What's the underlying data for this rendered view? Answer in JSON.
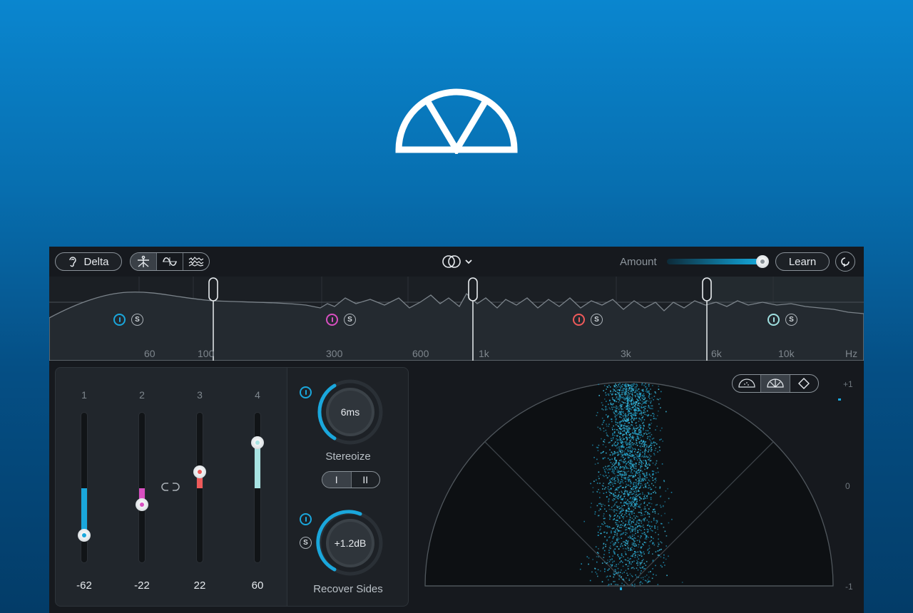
{
  "header": {
    "logo": "ozone-imager-logo"
  },
  "toolbar": {
    "delta_label": "Delta",
    "amount_label": "Amount",
    "amount_value_pct": 97,
    "learn_label": "Learn",
    "modes": [
      "stereoize-mode-icon",
      "sine-mode-icon",
      "noise-mode-icon"
    ],
    "active_mode": 0
  },
  "spectrum": {
    "freq_labels": [
      "60",
      "100",
      "300",
      "600",
      "1k",
      "3k",
      "6k",
      "10k",
      "Hz"
    ],
    "bands": [
      {
        "color": "#1aa7dc"
      },
      {
        "color": "#d84fc0"
      },
      {
        "color": "#ef5a5a"
      },
      {
        "color": "#9fe0e0"
      }
    ],
    "solo_label": "S"
  },
  "band_sliders": {
    "numbers": [
      "1",
      "2",
      "3",
      "4"
    ],
    "values": [
      "-62",
      "-22",
      "22",
      "60"
    ],
    "colors": [
      "#1aa7dc",
      "#d84fc0",
      "#ef5a5a",
      "#a8e3e3"
    ],
    "width_values": [
      -62,
      -22,
      22,
      60
    ]
  },
  "stereoize": {
    "value": "6ms",
    "label": "Stereoize",
    "mode_i": "I",
    "mode_ii": "II"
  },
  "recover_sides": {
    "value": "+1.2dB",
    "label": "Recover Sides",
    "solo_label": "S"
  },
  "vectorscope": {
    "scale": [
      "+1",
      "0",
      "-1"
    ],
    "views": [
      "polar-sample-icon",
      "polar-level-icon",
      "lissajous-icon"
    ],
    "active_view": 1
  }
}
